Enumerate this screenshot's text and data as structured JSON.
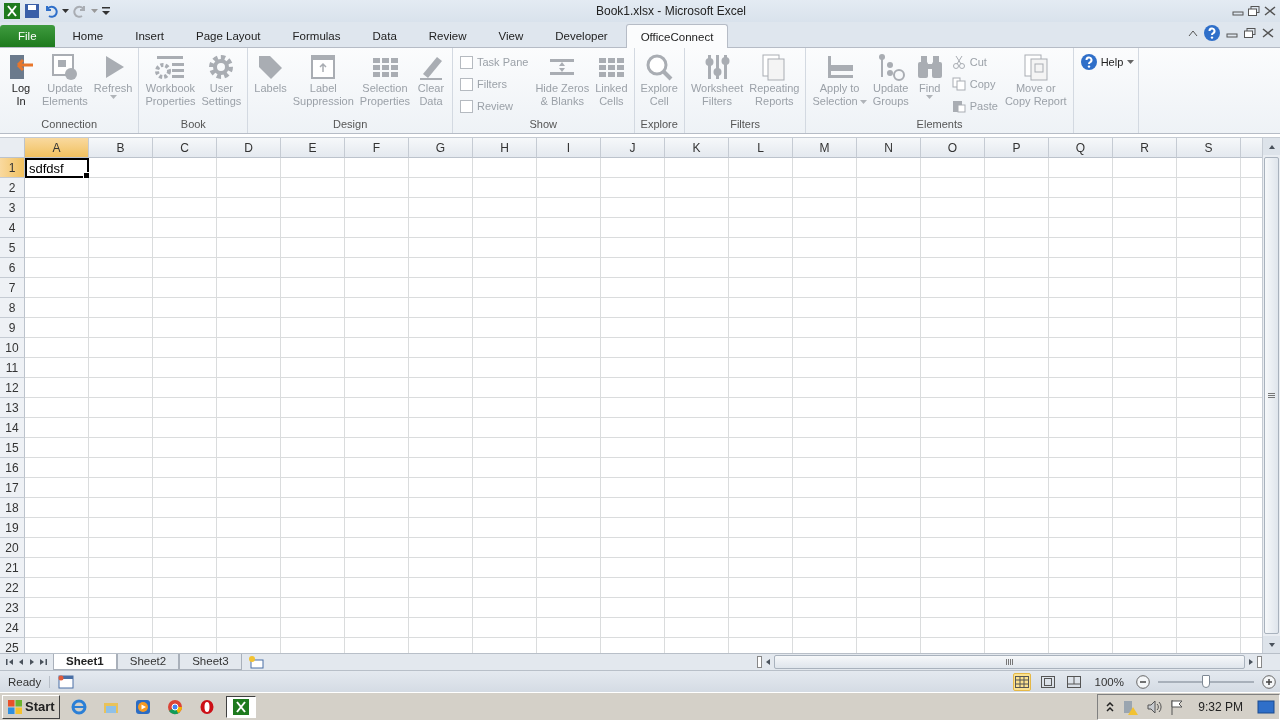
{
  "window": {
    "title": "Book1.xlsx - Microsoft Excel"
  },
  "tabs": [
    {
      "label": "File",
      "kind": "file",
      "selected": false
    },
    {
      "label": "Home",
      "kind": "tab",
      "selected": false
    },
    {
      "label": "Insert",
      "kind": "tab",
      "selected": false
    },
    {
      "label": "Page Layout",
      "kind": "tab",
      "selected": false
    },
    {
      "label": "Formulas",
      "kind": "tab",
      "selected": false
    },
    {
      "label": "Data",
      "kind": "tab",
      "selected": false
    },
    {
      "label": "Review",
      "kind": "tab",
      "selected": false
    },
    {
      "label": "View",
      "kind": "tab",
      "selected": false
    },
    {
      "label": "Developer",
      "kind": "tab",
      "selected": false
    },
    {
      "label": "OfficeConnect",
      "kind": "tab",
      "selected": true
    }
  ],
  "ribbon": {
    "groups": [
      {
        "label": "Connection",
        "items": [
          {
            "kind": "large",
            "lines": [
              "Log",
              "In"
            ],
            "disabled": false
          },
          {
            "kind": "large",
            "lines": [
              "Update",
              "Elements"
            ],
            "disabled": true
          },
          {
            "kind": "large",
            "lines": [
              "Refresh"
            ],
            "disabled": true,
            "dropdown": true
          }
        ]
      },
      {
        "label": "Book",
        "items": [
          {
            "kind": "large",
            "lines": [
              "Workbook",
              "Properties"
            ],
            "disabled": true
          },
          {
            "kind": "large",
            "lines": [
              "User",
              "Settings"
            ],
            "disabled": true
          }
        ]
      },
      {
        "label": "Design",
        "items": [
          {
            "kind": "large",
            "lines": [
              "Labels"
            ],
            "disabled": true
          },
          {
            "kind": "large",
            "lines": [
              "Label",
              "Suppression"
            ],
            "disabled": true
          },
          {
            "kind": "large",
            "lines": [
              "Selection",
              "Properties"
            ],
            "disabled": true
          },
          {
            "kind": "large",
            "lines": [
              "Clear",
              "Data"
            ],
            "disabled": true
          }
        ]
      },
      {
        "label": "Show",
        "items": [
          {
            "kind": "check",
            "lines": [
              "Task Pane"
            ],
            "disabled": true,
            "checked": false
          },
          {
            "kind": "check",
            "lines": [
              "Filters"
            ],
            "disabled": true,
            "checked": false
          },
          {
            "kind": "check",
            "lines": [
              "Review"
            ],
            "disabled": true,
            "checked": false
          },
          {
            "kind": "large",
            "lines": [
              "Hide Zeros",
              "& Blanks"
            ],
            "disabled": true
          },
          {
            "kind": "large",
            "lines": [
              "Linked",
              "Cells"
            ],
            "disabled": true
          }
        ]
      },
      {
        "label": "Explore",
        "items": [
          {
            "kind": "large",
            "lines": [
              "Explore",
              "Cell"
            ],
            "disabled": true
          }
        ]
      },
      {
        "label": "Filters",
        "items": [
          {
            "kind": "large",
            "lines": [
              "Worksheet",
              "Filters"
            ],
            "disabled": true
          },
          {
            "kind": "large",
            "lines": [
              "Repeating",
              "Reports"
            ],
            "disabled": true
          }
        ]
      },
      {
        "label": "Elements",
        "items": [
          {
            "kind": "large",
            "lines": [
              "Apply to",
              "Selection"
            ],
            "disabled": true,
            "dropdown": true
          },
          {
            "kind": "large",
            "lines": [
              "Update",
              "Groups"
            ],
            "disabled": true
          },
          {
            "kind": "large",
            "lines": [
              "Find"
            ],
            "disabled": true,
            "dropdown": true
          },
          {
            "kind": "small",
            "lines": [
              "Cut"
            ],
            "disabled": true
          },
          {
            "kind": "small",
            "lines": [
              "Copy"
            ],
            "disabled": true
          },
          {
            "kind": "small",
            "lines": [
              "Paste"
            ],
            "disabled": true
          },
          {
            "kind": "large",
            "lines": [
              "Move or",
              "Copy Report"
            ],
            "disabled": true
          }
        ]
      },
      {
        "items": [
          {
            "kind": "menu",
            "lines": [
              "Help"
            ],
            "disabled": false,
            "dropdown": true
          }
        ]
      }
    ]
  },
  "sheet": {
    "columns": [
      {
        "label": "A",
        "selected": true
      },
      {
        "label": "B",
        "selected": false
      },
      {
        "label": "C",
        "selected": false
      },
      {
        "label": "D",
        "selected": false
      },
      {
        "label": "E",
        "selected": false
      },
      {
        "label": "F",
        "selected": false
      },
      {
        "label": "G",
        "selected": false
      },
      {
        "label": "H",
        "selected": false
      },
      {
        "label": "I",
        "selected": false
      },
      {
        "label": "J",
        "selected": false
      },
      {
        "label": "K",
        "selected": false
      },
      {
        "label": "L",
        "selected": false
      },
      {
        "label": "M",
        "selected": false
      },
      {
        "label": "N",
        "selected": false
      },
      {
        "label": "O",
        "selected": false
      },
      {
        "label": "P",
        "selected": false
      },
      {
        "label": "Q",
        "selected": false
      },
      {
        "label": "R",
        "selected": false
      },
      {
        "label": "S",
        "selected": false
      }
    ],
    "rows": [
      {
        "label": "1",
        "selected": true,
        "cells": [
          {
            "value": "sdfdsf",
            "selected": true
          }
        ]
      },
      {
        "label": "2",
        "selected": false
      },
      {
        "label": "3",
        "selected": false
      },
      {
        "label": "4",
        "selected": false
      },
      {
        "label": "5",
        "selected": false
      },
      {
        "label": "6",
        "selected": false
      },
      {
        "label": "7",
        "selected": false
      },
      {
        "label": "8",
        "selected": false
      },
      {
        "label": "9",
        "selected": false
      },
      {
        "label": "10",
        "selected": false
      },
      {
        "label": "11",
        "selected": false
      },
      {
        "label": "12",
        "selected": false
      },
      {
        "label": "13",
        "selected": false
      },
      {
        "label": "14",
        "selected": false
      },
      {
        "label": "15",
        "selected": false
      },
      {
        "label": "16",
        "selected": false
      },
      {
        "label": "17",
        "selected": false
      },
      {
        "label": "18",
        "selected": false
      },
      {
        "label": "19",
        "selected": false
      },
      {
        "label": "20",
        "selected": false
      },
      {
        "label": "21",
        "selected": false
      },
      {
        "label": "22",
        "selected": false
      },
      {
        "label": "23",
        "selected": false
      },
      {
        "label": "24",
        "selected": false
      },
      {
        "label": "25",
        "selected": false
      }
    ]
  },
  "sheet_tabs": [
    {
      "label": "Sheet1",
      "selected": true
    },
    {
      "label": "Sheet2",
      "selected": false
    },
    {
      "label": "Sheet3",
      "selected": false
    }
  ],
  "status_bar": {
    "text": "Ready",
    "views": [
      {
        "selected": true
      },
      {
        "selected": false
      },
      {
        "selected": false
      }
    ],
    "zoom": "100%",
    "zoom_slider": {
      "level": 0.5
    }
  },
  "taskbar": {
    "start": "Start",
    "apps": [
      {
        "selected": false
      },
      {
        "selected": false
      },
      {
        "selected": false
      },
      {
        "selected": false
      },
      {
        "selected": false
      },
      {
        "selected": true
      }
    ],
    "clock": "9:32 PM"
  }
}
